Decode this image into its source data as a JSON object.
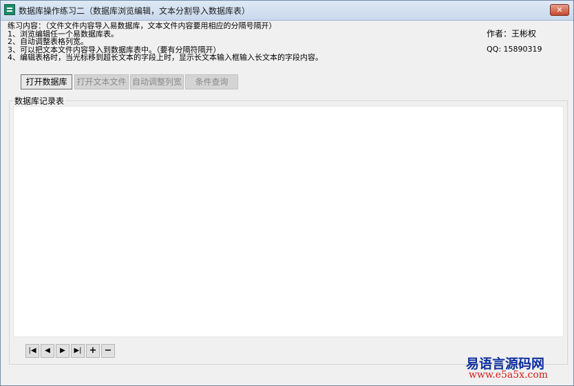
{
  "window": {
    "title": "数据库操作练习二（数据库浏览编辑，文本分割导入数据库表）",
    "close_label": "✕"
  },
  "description": {
    "lines": [
      "练习内容：（文件文件内容导入易数据库，文本文件内容要用相应的分隔号隔开）",
      "1、浏览编辑任一个易数据库表。",
      "2、自动调整表格列宽。",
      "3、可以把文本文件内容导入到数据库表中。（要有分隔符隔开）",
      "4、编辑表格时，当光标移到超长文本的字段上时，显示长文本输入框输入长文本的字段内容。"
    ]
  },
  "author": {
    "name": "作者：王彬权",
    "qq": "QQ: 15890319"
  },
  "toolbar": {
    "open_db": "打开数据库",
    "open_text": "打开文本文件",
    "auto_width": "自动调整列宽",
    "query": "条件查询"
  },
  "group": {
    "label": "数据库记录表"
  },
  "nav": {
    "first": "|◀",
    "prev": "◀",
    "next": "▶",
    "last": "▶|",
    "add": "+",
    "remove": "−"
  },
  "watermark": {
    "line1": "易语言源码网",
    "line2": "www.e5a5x.com"
  }
}
